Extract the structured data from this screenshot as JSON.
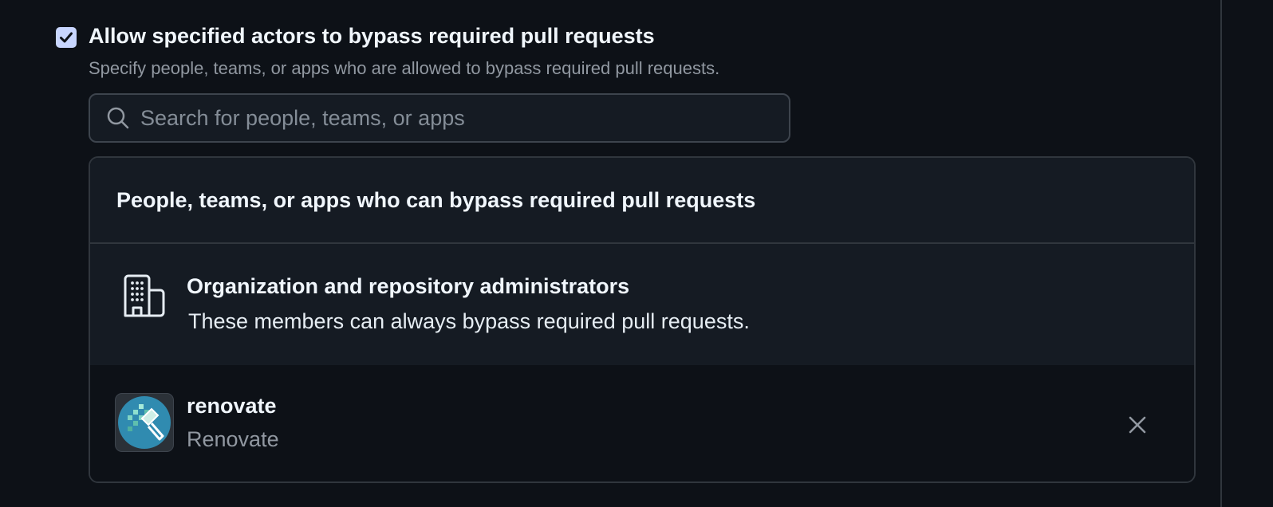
{
  "bypass_option": {
    "checked": true,
    "title": "Allow specified actors to bypass required pull requests",
    "description": "Specify people, teams, or apps who are allowed to bypass required pull requests."
  },
  "search": {
    "placeholder": "Search for people, teams, or apps",
    "value": ""
  },
  "panel": {
    "header": "People, teams, or apps who can bypass required pull requests",
    "admins": {
      "icon": "organization-icon",
      "title": "Organization and repository administrators",
      "description": "These members can always bypass required pull requests."
    },
    "actors": [
      {
        "name": "renovate",
        "login": "Renovate",
        "avatar_icon": "renovate-logo",
        "remove_icon": "close-icon"
      }
    ]
  },
  "colors": {
    "background": "#0d1117",
    "panel": "#151b23",
    "border": "#30363d",
    "checkbox": "#c8d6ff",
    "renovate_logo": "#308bb0"
  }
}
